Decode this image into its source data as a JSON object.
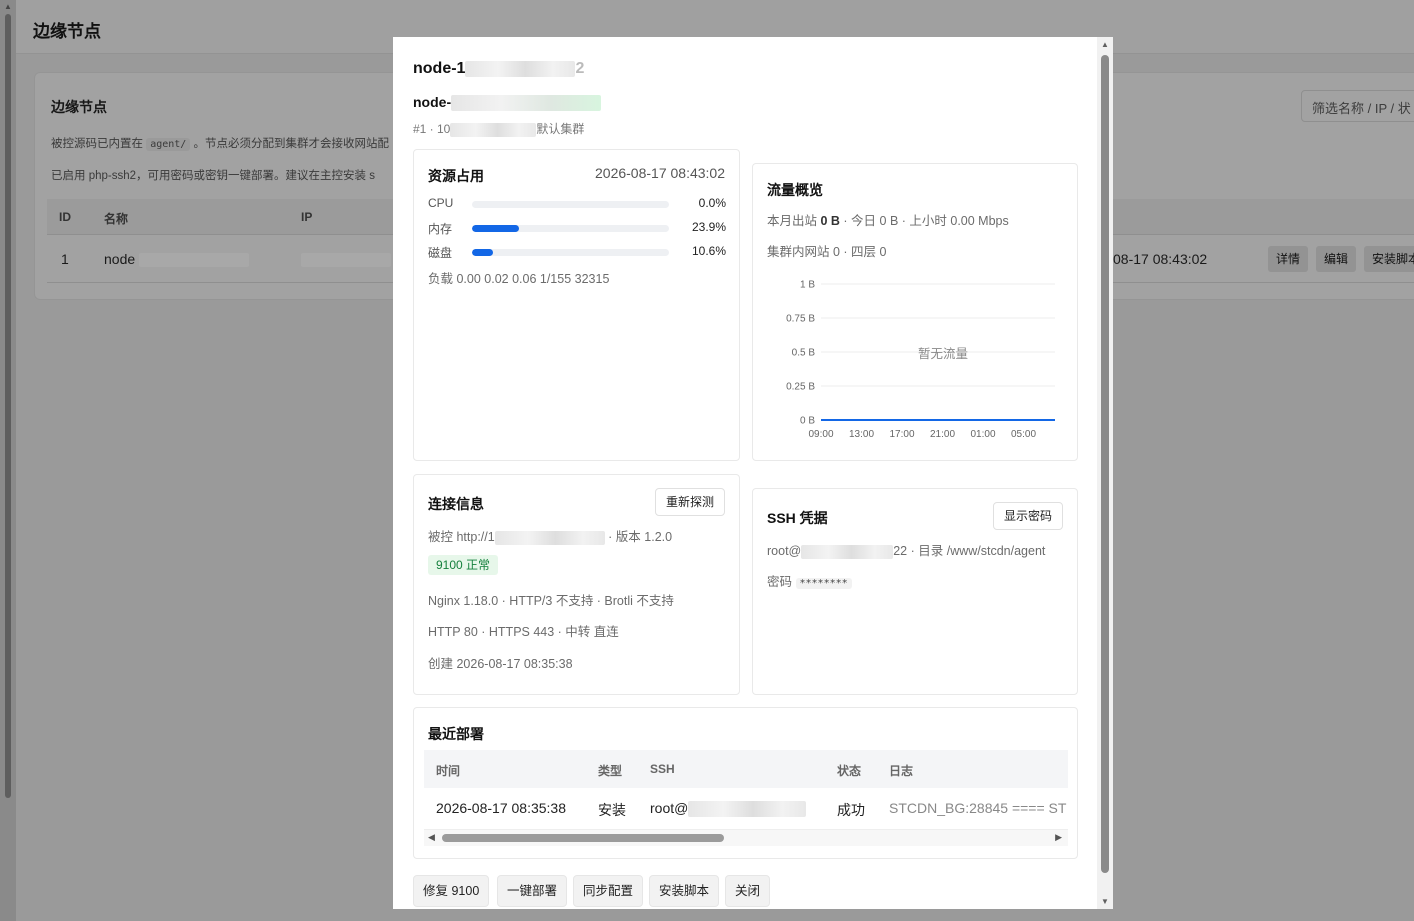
{
  "page": {
    "title": "边缘节点",
    "card_title": "边缘节点",
    "filter_placeholder": "筛选名称 / IP / 状",
    "note1_prefix": "被控源码已内置在",
    "note1_code": "agent/",
    "note1_suffix": "。节点必须分配到集群才会接收网站配",
    "note2": "已启用 php-ssh2，可用密码或密钥一键部署。建议在主控安装 s",
    "columns": {
      "id": "ID",
      "name": "名称",
      "ip": "IP"
    },
    "row": {
      "id": "1",
      "name": "node",
      "time": "08-17 08:43:02",
      "btn_detail": "详情",
      "btn_edit": "编辑",
      "btn_install": "安装脚本"
    }
  },
  "modal": {
    "title": "node-1",
    "title_tail": "2",
    "subtitle": "node-",
    "meta_prefix": "#1 · 10",
    "meta_suffix": "默认集群",
    "resources": {
      "title": "资源占用",
      "time": "2026-08-17 08:43:02",
      "rows": [
        {
          "label": "CPU",
          "value": "0.0%",
          "level": 0.0
        },
        {
          "label": "内存",
          "value": "23.9%",
          "level": 23.9
        },
        {
          "label": "磁盘",
          "value": "10.6%",
          "level": 10.6
        }
      ],
      "load": "负载 0.00 0.02 0.06 1/155 32315"
    },
    "traffic": {
      "title": "流量概览",
      "line1_a": "本月出站 ",
      "line1_b": "0 B",
      "line1_c": " · 今日 0 B · 上小时 0.00 Mbps",
      "line2": "集群内网站 0 · 四层 0",
      "empty_text": "暂无流量",
      "line_color": "#1367e6"
    },
    "connection": {
      "title": "连接信息",
      "reprobe_btn": "重新探测",
      "agent_prefix": "被控 http://1",
      "agent_suffix": " · 版本 1.2.0",
      "status_badge": "9100 正常",
      "line_nginx": "Nginx 1.18.0 · HTTP/3 不支持 · Brotli 不支持",
      "line_ports": "HTTP 80 · HTTPS 443 · 中转 直连",
      "line_created": "创建 2026-08-17 08:35:38"
    },
    "ssh": {
      "title": "SSH 凭据",
      "show_btn": "显示密码",
      "user_prefix": "root@",
      "user_suffix": "22 · 目录 /www/stcdn/agent",
      "pw_label": "密码",
      "pw_mask": "********"
    },
    "deploy": {
      "title": "最近部署",
      "columns": {
        "time": "时间",
        "type": "类型",
        "ssh": "SSH",
        "status": "状态",
        "log": "日志"
      },
      "row": {
        "time": "2026-08-17 08:35:38",
        "type": "安装",
        "ssh": "root@",
        "status": "成功",
        "log": "STCDN_BG:28845 ==== ST"
      }
    },
    "footer": {
      "repair": "修复 9100",
      "deploy": "一键部署",
      "sync": "同步配置",
      "script": "安装脚本",
      "close": "关闭"
    }
  },
  "chart_data": {
    "type": "line",
    "title": "",
    "x": [
      "09:00",
      "13:00",
      "17:00",
      "21:00",
      "01:00",
      "05:00"
    ],
    "y_ticks": [
      "0 B",
      "0.25 B",
      "0.5 B",
      "0.75 B",
      "1 B"
    ],
    "ylim": [
      0,
      1
    ],
    "series": [
      {
        "values": [
          0,
          0,
          0,
          0,
          0,
          0
        ]
      }
    ],
    "annotation": "暂无流量",
    "grid": true
  }
}
